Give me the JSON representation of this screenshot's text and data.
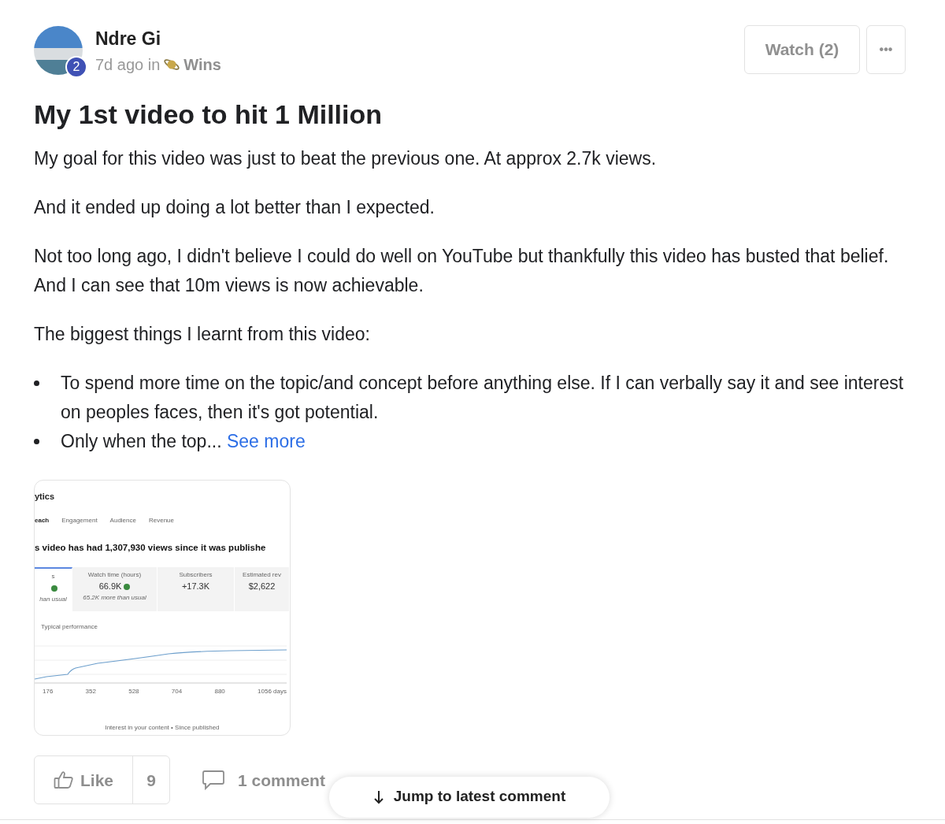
{
  "author": {
    "name": "Ndre Gi",
    "level_badge": "2",
    "time": "7d ago in",
    "category": "Wins"
  },
  "header_buttons": {
    "watch": "Watch (2)",
    "more": "•••"
  },
  "post": {
    "title": "My 1st video to hit 1 Million",
    "paragraphs": [
      "My goal for this video was just to beat the previous one. At approx 2.7k views.",
      "And it ended up doing a lot better than I expected.",
      "Not too long ago, I didn't believe I could do well on YouTube but thankfully this video has busted that belief. And I can see that 10m views is now achievable.",
      "The biggest things I learnt from this video:"
    ],
    "bullets": [
      "To spend more time on the topic/and concept before anything else. If I can verbally say it and see interest on peoples faces, then it's got potential.",
      "Only when the top..."
    ],
    "see_more": "See more"
  },
  "attachment": {
    "page_title": "ytics",
    "tabs": [
      {
        "label": "each",
        "selected": true
      },
      {
        "label": "Engagement",
        "selected": false
      },
      {
        "label": "Audience",
        "selected": false
      },
      {
        "label": "Revenue",
        "selected": false
      }
    ],
    "headline": "s video has had 1,307,930 views since it was publishe",
    "metrics": [
      {
        "label": "s",
        "note": "han usual",
        "selected": true,
        "trend_up": true
      },
      {
        "label": "Watch time (hours)",
        "value": "66.9K",
        "note": "65.2K more than usual",
        "selected": false,
        "trend_up": true
      },
      {
        "label": "Subscribers",
        "value": "+17.3K",
        "selected": false,
        "trend_up": false
      },
      {
        "label": "Estimated rev",
        "value": "$2,622",
        "selected": false,
        "trend_up": false
      }
    ],
    "legend": "Typical performance",
    "x_axis_labels": [
      "176",
      "352",
      "528",
      "704",
      "880",
      "1056 days"
    ],
    "footer": "Interest in your content • Since published"
  },
  "actions": {
    "like": "Like",
    "like_count": "9",
    "comments": "1 comment"
  },
  "jump_button": "Jump to latest comment"
}
